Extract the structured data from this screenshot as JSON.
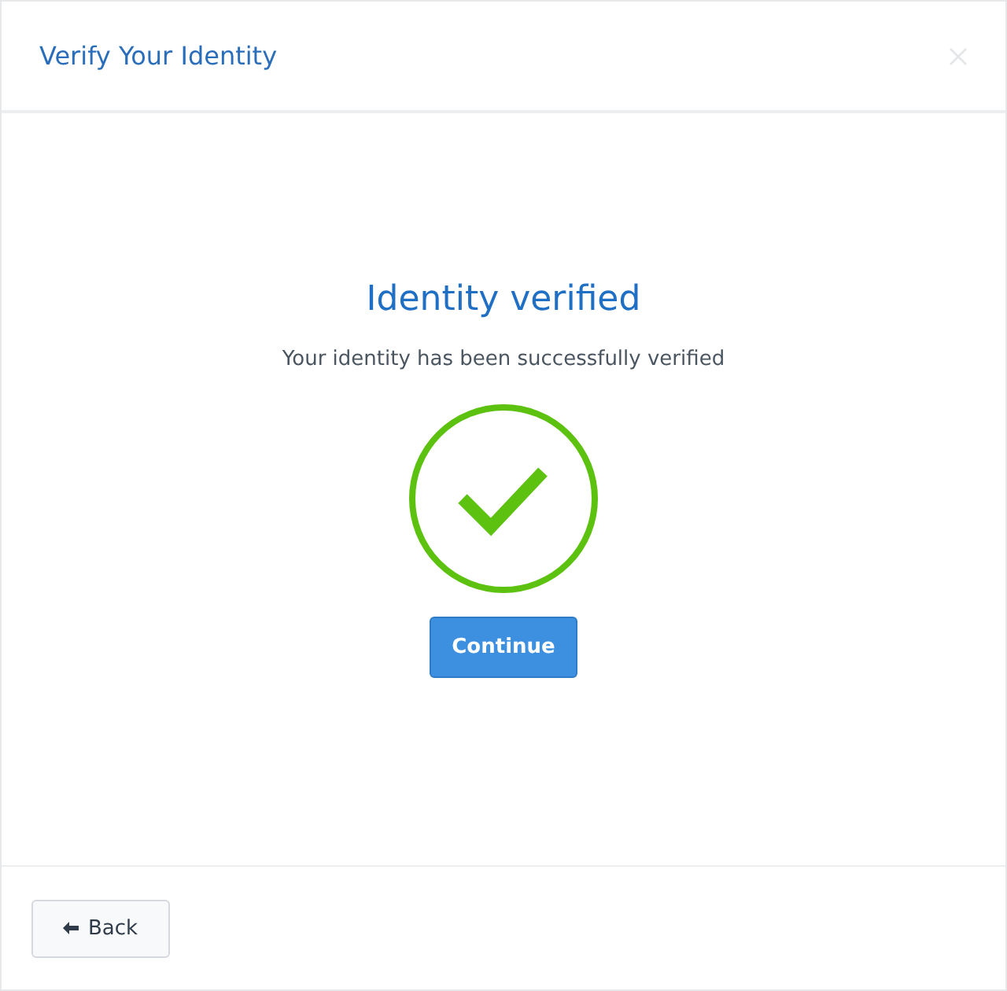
{
  "dialog": {
    "title": "Verify Your Identity"
  },
  "content": {
    "heading": "Identity verified",
    "message": "Your identity has been successfully verified",
    "primary_button": "Continue"
  },
  "footer": {
    "back_button": "Back"
  }
}
